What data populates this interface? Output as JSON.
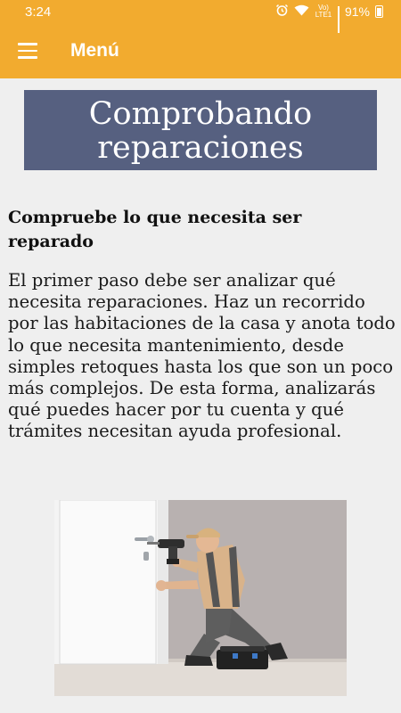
{
  "status_bar": {
    "time": "3:24",
    "network_label": "Vo) LTE1",
    "battery_percent": "91%",
    "icons": [
      "alarm-icon",
      "wifi-icon",
      "signal-icon",
      "battery-icon"
    ]
  },
  "app_bar": {
    "menu_icon": "hamburger-menu-icon",
    "title": "Menú",
    "color": "#f2ab2f"
  },
  "article": {
    "banner_line1": "Comprobando",
    "banner_line2": "reparaciones",
    "banner_color": "#566080",
    "heading": "Compruebe lo que necesita ser reparado",
    "body": " El primer paso debe ser analizar qué necesita reparaciones. Haz un recorrido por las habitaciones de la casa y anota todo lo que necesita mantenimiento, desde simples retoques hasta los que son un poco más complejos. De esta forma, analizarás qué puedes hacer por tu cuenta y qué trámites necesitan ayuda profesional.",
    "image": "repairman-drilling-door-photo"
  }
}
